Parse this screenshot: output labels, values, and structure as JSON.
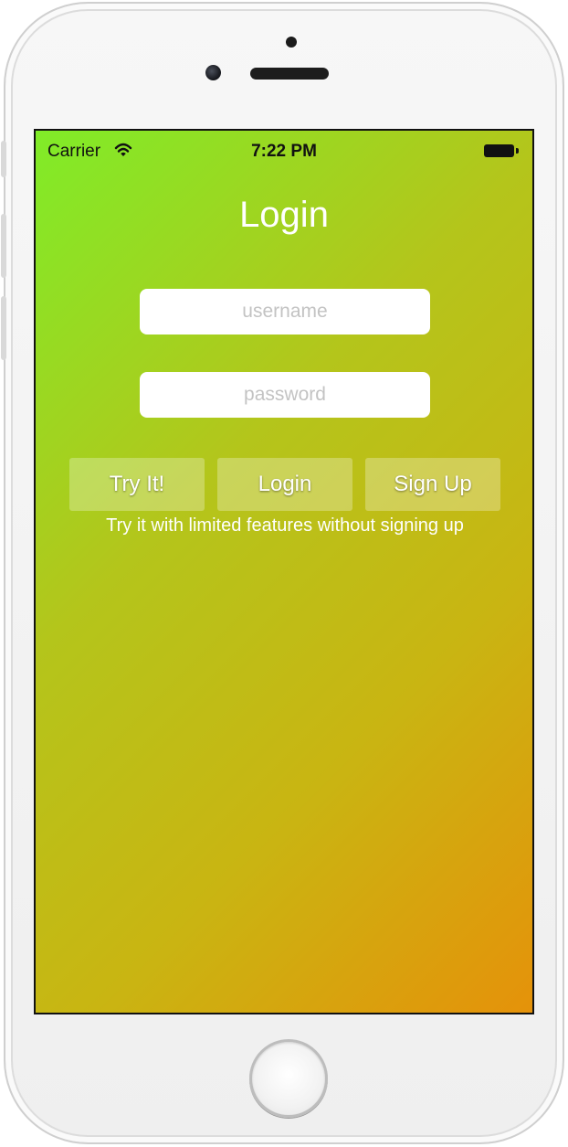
{
  "status_bar": {
    "carrier": "Carrier",
    "time": "7:22 PM",
    "wifi_icon": "wifi-icon",
    "battery_icon": "battery-icon"
  },
  "login": {
    "title": "Login",
    "username_placeholder": "username",
    "password_placeholder": "password",
    "buttons": {
      "try_it": "Try It!",
      "login": "Login",
      "sign_up": "Sign Up"
    },
    "hint": "Try it with limited features without signing up"
  },
  "colors": {
    "gradient_start": "#80ec28",
    "gradient_end": "#e5920a",
    "button_overlay": "rgba(255,255,255,0.28)"
  }
}
